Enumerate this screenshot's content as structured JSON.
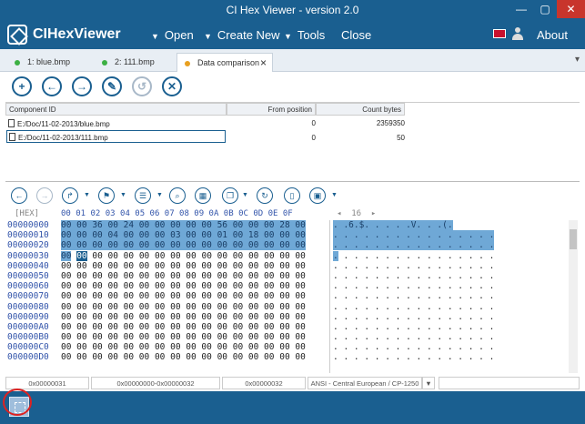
{
  "window": {
    "title": "CI Hex Viewer - version 2.0",
    "min": "—",
    "max": "▢",
    "close": "✕"
  },
  "menu": {
    "app_name": "CIHexViewer",
    "open": "Open",
    "create_new": "Create New",
    "tools": "Tools",
    "close": "Close",
    "about": "About"
  },
  "tabs": [
    {
      "label": "1: blue.bmp",
      "dot_color": "#3cb043"
    },
    {
      "label": "2: 111.bmp",
      "dot_color": "#3cb043"
    },
    {
      "label": "Data comparison",
      "dot_color": "#e8a020"
    }
  ],
  "component_grid": {
    "headers": {
      "component": "Component ID",
      "from": "From position",
      "count": "Count bytes"
    },
    "rows": [
      {
        "path": "E:/Doc/11-02-2013/blue.bmp",
        "from": "0",
        "count": "2359350"
      },
      {
        "path": "E:/Doc/11-02-2013/111.bmp",
        "from": "0",
        "count": "50"
      }
    ]
  },
  "hex": {
    "header_label": "[HEX]",
    "columns": "00 01 02 03 04 05 06 07 08 09 0A 0B 0C 0D 0E 0F",
    "page_label": "◂  16  ▸",
    "offsets": [
      "00000000",
      "00000010",
      "00000020",
      "00000030",
      "00000040",
      "00000050",
      "00000060",
      "00000070",
      "00000080",
      "00000090",
      "000000A0",
      "000000B0",
      "000000C0",
      "000000D0"
    ],
    "highlighted_rows": [
      "00 00 36 00 24 00 00 00 00 00 56 00 00 00 28 00",
      "00 00 00 04 00 00 00 03 00 00 01 00 18 00 00 00",
      "00 00 00 00 00 00 00 00 00 00 00 00 00 00 00 00"
    ],
    "row30_selected": "00",
    "row30_cursor": "00",
    "row30_rest": " 00 00 00 00 00 00 00 00 00 00 00 00 00 00",
    "zero_row": "00 00 00 00 00 00 00 00 00 00 00 00 00 00 00 00",
    "ascii_highlighted": [
      ". .6.$. . . . .V. . .(.",
      ". . . . . . . . . . . . . . . .",
      ". . . . . . . . . . . . . . . ."
    ],
    "ascii_row30_cursor": ".",
    "ascii_row30_rest": ". . . . . . . . . . . . . . .",
    "ascii_zero": ". . . . . . . . . . . . . . . ."
  },
  "status": {
    "cursor": "0x00000031",
    "selection": "0x00000000-0x00000032",
    "length": "0x00000032",
    "encoding": "ANSI - Central European / CP-1250",
    "encoding_arrow": "▼"
  }
}
